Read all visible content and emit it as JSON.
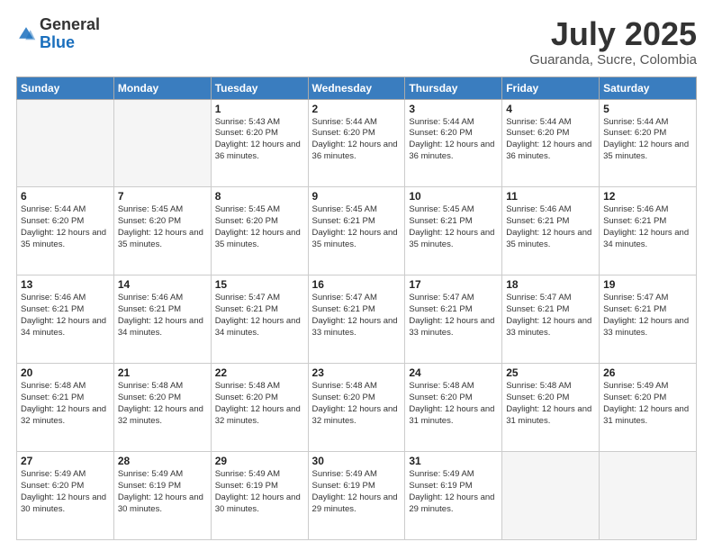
{
  "header": {
    "logo_general": "General",
    "logo_blue": "Blue",
    "month_title": "July 2025",
    "location": "Guaranda, Sucre, Colombia"
  },
  "days_of_week": [
    "Sunday",
    "Monday",
    "Tuesday",
    "Wednesday",
    "Thursday",
    "Friday",
    "Saturday"
  ],
  "weeks": [
    [
      {
        "day": "",
        "info": ""
      },
      {
        "day": "",
        "info": ""
      },
      {
        "day": "1",
        "info": "Sunrise: 5:43 AM\nSunset: 6:20 PM\nDaylight: 12 hours and 36 minutes."
      },
      {
        "day": "2",
        "info": "Sunrise: 5:44 AM\nSunset: 6:20 PM\nDaylight: 12 hours and 36 minutes."
      },
      {
        "day": "3",
        "info": "Sunrise: 5:44 AM\nSunset: 6:20 PM\nDaylight: 12 hours and 36 minutes."
      },
      {
        "day": "4",
        "info": "Sunrise: 5:44 AM\nSunset: 6:20 PM\nDaylight: 12 hours and 36 minutes."
      },
      {
        "day": "5",
        "info": "Sunrise: 5:44 AM\nSunset: 6:20 PM\nDaylight: 12 hours and 35 minutes."
      }
    ],
    [
      {
        "day": "6",
        "info": "Sunrise: 5:44 AM\nSunset: 6:20 PM\nDaylight: 12 hours and 35 minutes."
      },
      {
        "day": "7",
        "info": "Sunrise: 5:45 AM\nSunset: 6:20 PM\nDaylight: 12 hours and 35 minutes."
      },
      {
        "day": "8",
        "info": "Sunrise: 5:45 AM\nSunset: 6:20 PM\nDaylight: 12 hours and 35 minutes."
      },
      {
        "day": "9",
        "info": "Sunrise: 5:45 AM\nSunset: 6:21 PM\nDaylight: 12 hours and 35 minutes."
      },
      {
        "day": "10",
        "info": "Sunrise: 5:45 AM\nSunset: 6:21 PM\nDaylight: 12 hours and 35 minutes."
      },
      {
        "day": "11",
        "info": "Sunrise: 5:46 AM\nSunset: 6:21 PM\nDaylight: 12 hours and 35 minutes."
      },
      {
        "day": "12",
        "info": "Sunrise: 5:46 AM\nSunset: 6:21 PM\nDaylight: 12 hours and 34 minutes."
      }
    ],
    [
      {
        "day": "13",
        "info": "Sunrise: 5:46 AM\nSunset: 6:21 PM\nDaylight: 12 hours and 34 minutes."
      },
      {
        "day": "14",
        "info": "Sunrise: 5:46 AM\nSunset: 6:21 PM\nDaylight: 12 hours and 34 minutes."
      },
      {
        "day": "15",
        "info": "Sunrise: 5:47 AM\nSunset: 6:21 PM\nDaylight: 12 hours and 34 minutes."
      },
      {
        "day": "16",
        "info": "Sunrise: 5:47 AM\nSunset: 6:21 PM\nDaylight: 12 hours and 33 minutes."
      },
      {
        "day": "17",
        "info": "Sunrise: 5:47 AM\nSunset: 6:21 PM\nDaylight: 12 hours and 33 minutes."
      },
      {
        "day": "18",
        "info": "Sunrise: 5:47 AM\nSunset: 6:21 PM\nDaylight: 12 hours and 33 minutes."
      },
      {
        "day": "19",
        "info": "Sunrise: 5:47 AM\nSunset: 6:21 PM\nDaylight: 12 hours and 33 minutes."
      }
    ],
    [
      {
        "day": "20",
        "info": "Sunrise: 5:48 AM\nSunset: 6:21 PM\nDaylight: 12 hours and 32 minutes."
      },
      {
        "day": "21",
        "info": "Sunrise: 5:48 AM\nSunset: 6:20 PM\nDaylight: 12 hours and 32 minutes."
      },
      {
        "day": "22",
        "info": "Sunrise: 5:48 AM\nSunset: 6:20 PM\nDaylight: 12 hours and 32 minutes."
      },
      {
        "day": "23",
        "info": "Sunrise: 5:48 AM\nSunset: 6:20 PM\nDaylight: 12 hours and 32 minutes."
      },
      {
        "day": "24",
        "info": "Sunrise: 5:48 AM\nSunset: 6:20 PM\nDaylight: 12 hours and 31 minutes."
      },
      {
        "day": "25",
        "info": "Sunrise: 5:48 AM\nSunset: 6:20 PM\nDaylight: 12 hours and 31 minutes."
      },
      {
        "day": "26",
        "info": "Sunrise: 5:49 AM\nSunset: 6:20 PM\nDaylight: 12 hours and 31 minutes."
      }
    ],
    [
      {
        "day": "27",
        "info": "Sunrise: 5:49 AM\nSunset: 6:20 PM\nDaylight: 12 hours and 30 minutes."
      },
      {
        "day": "28",
        "info": "Sunrise: 5:49 AM\nSunset: 6:19 PM\nDaylight: 12 hours and 30 minutes."
      },
      {
        "day": "29",
        "info": "Sunrise: 5:49 AM\nSunset: 6:19 PM\nDaylight: 12 hours and 30 minutes."
      },
      {
        "day": "30",
        "info": "Sunrise: 5:49 AM\nSunset: 6:19 PM\nDaylight: 12 hours and 29 minutes."
      },
      {
        "day": "31",
        "info": "Sunrise: 5:49 AM\nSunset: 6:19 PM\nDaylight: 12 hours and 29 minutes."
      },
      {
        "day": "",
        "info": ""
      },
      {
        "day": "",
        "info": ""
      }
    ]
  ]
}
